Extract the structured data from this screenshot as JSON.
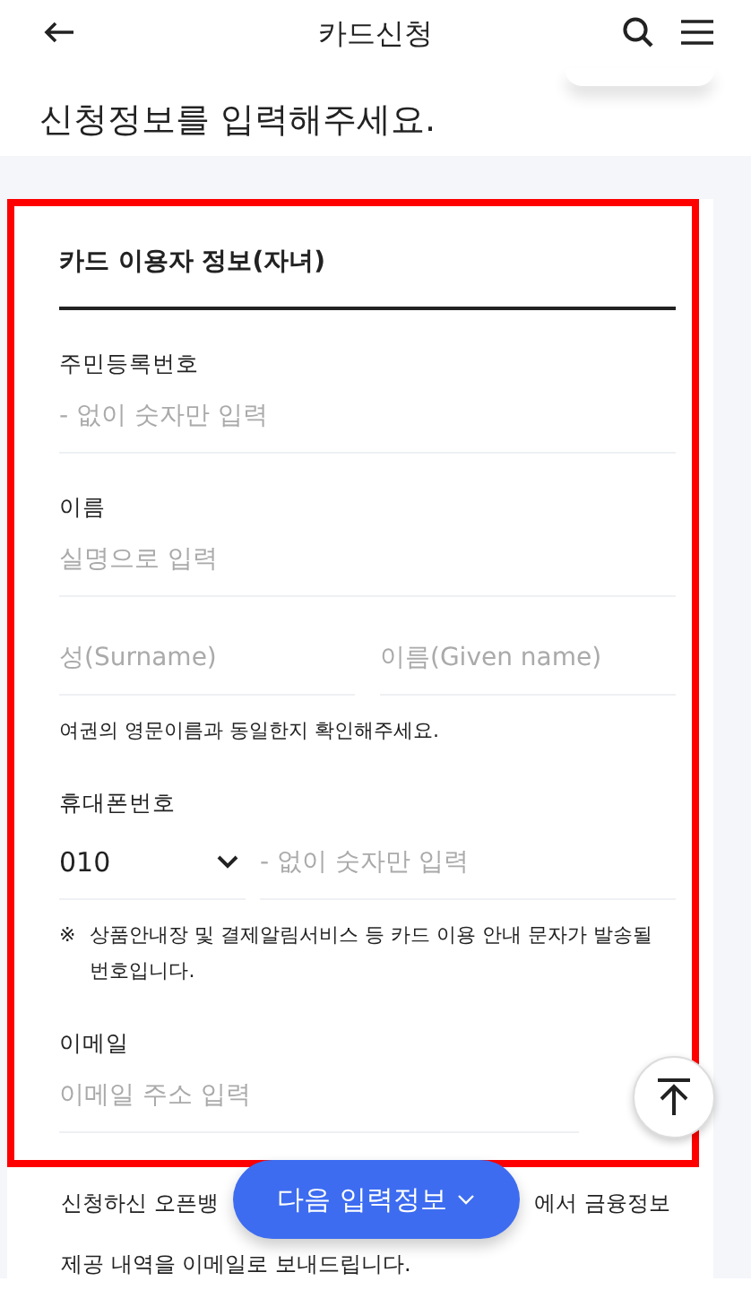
{
  "header": {
    "title": "카드신청"
  },
  "heading": "신청정보를 입력해주세요.",
  "section_title": "카드 이용자 정보(자녀)",
  "fields": [
    {
      "kind": "text",
      "label": "주민등록번호",
      "placeholder": "- 없이 숫자만 입력"
    },
    {
      "kind": "text",
      "label": "이름",
      "placeholder": "실명으로 입력"
    },
    {
      "kind": "split",
      "placeholders": [
        "성(Surname)",
        "이름(Given name)"
      ],
      "note": "여권의 영문이름과 동일한지 확인해주세요."
    },
    {
      "kind": "phone",
      "label": "휴대폰번호",
      "prefix": "010",
      "placeholder": "- 없이 숫자만 입력",
      "note_mark": "※",
      "note": "상품안내장 및 결제알림서비스 등 카드 이용 안내 문자가 발송될 번호입니다."
    },
    {
      "kind": "text",
      "label": "이메일",
      "placeholder": "이메일 주소 입력"
    }
  ],
  "footer_text": {
    "left": "신청하신 오픈뱅",
    "right": "에서 금융정보",
    "line2": "제공 내역을 이메일로 보내드립니다."
  },
  "next_button": "다음 입력정보"
}
